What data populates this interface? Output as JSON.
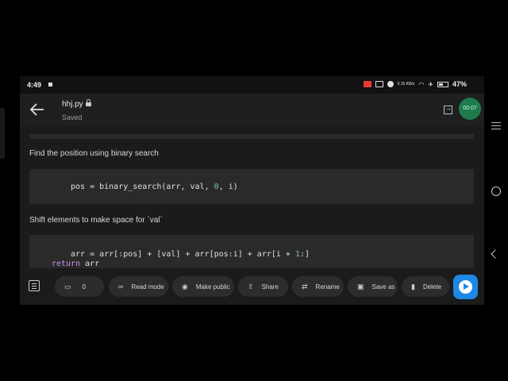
{
  "status": {
    "time": "4:49",
    "network": "0.15 KB/s",
    "battery": "47%"
  },
  "app": {
    "filename": "hhj.py",
    "status": "Saved",
    "timer": "00:07"
  },
  "content": {
    "comment1": "Find the position using binary search",
    "code1": {
      "pre": "pos = binary_search(arr, val, ",
      "n1": "0",
      "mid": ", i)"
    },
    "comment2": "Shift elements to make space for `val`",
    "code2": {
      "line1a": "arr = arr[:pos] + [val] + arr[pos:i] + arr[i + ",
      "line1n": "1",
      "line1b": ":]",
      "kw": "return",
      "line2b": " arr"
    }
  },
  "toolbar": {
    "comments_count": "0",
    "read_mode": "Read mode",
    "make_public": "Make public",
    "share": "Share",
    "rename": "Rename",
    "save_as": "Save as",
    "delete": "Delete"
  },
  "colors": {
    "run_button": "#1e88e5",
    "timer_bg": "#1f7a4d"
  }
}
